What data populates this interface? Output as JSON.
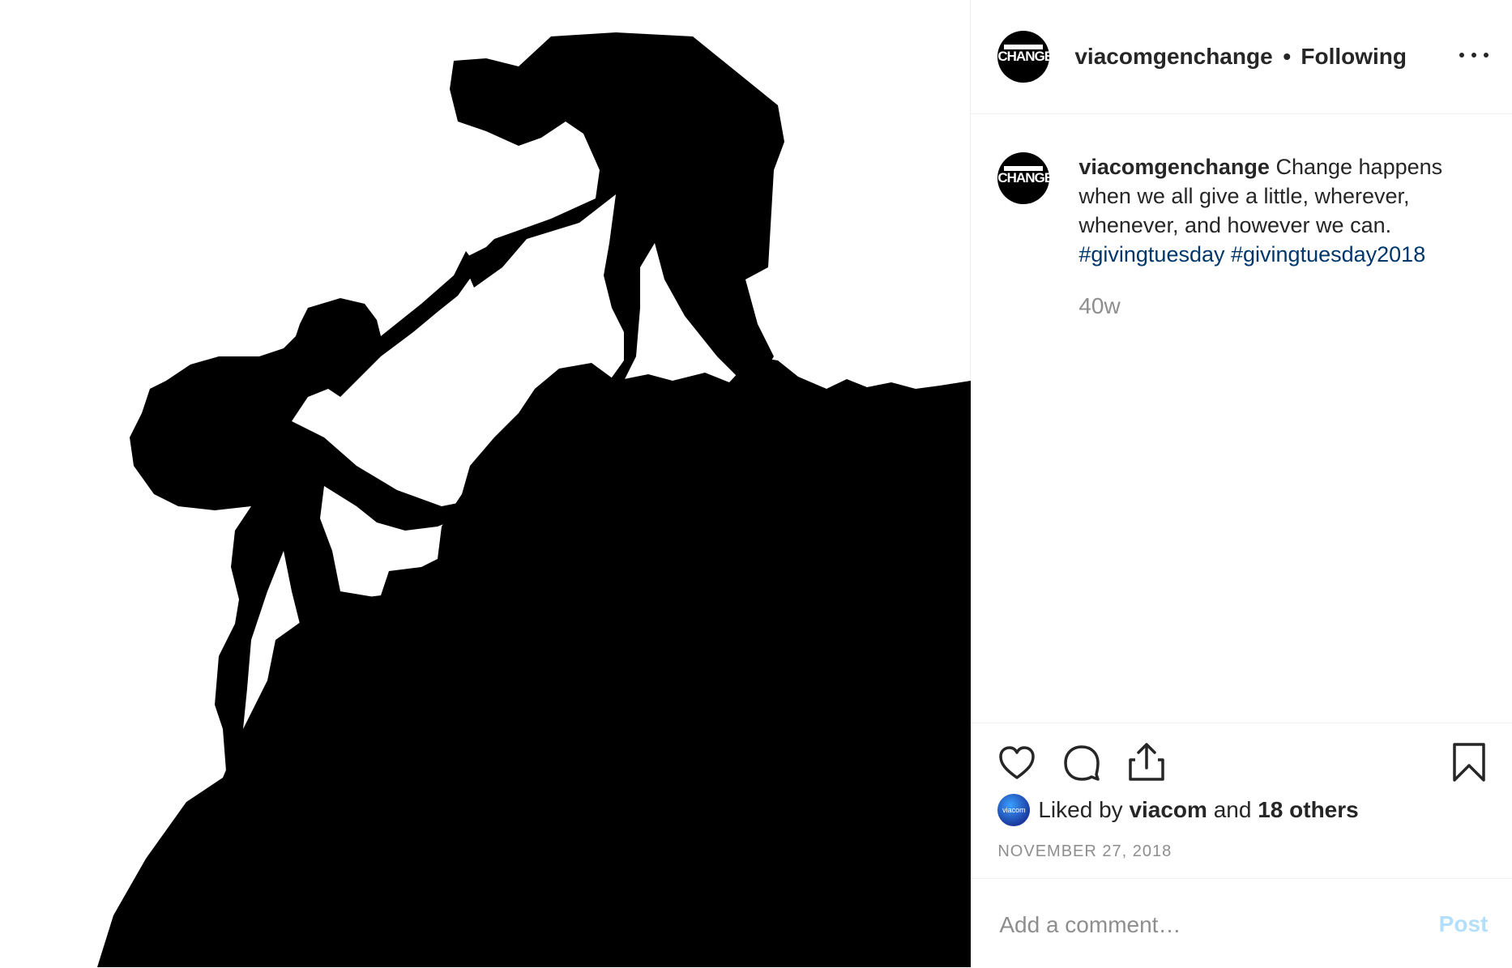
{
  "account": {
    "username": "viacomgenchange",
    "separator": "•",
    "follow_status": "Following",
    "avatar_text": "CHANGE",
    "more_icon": "more-horizontal-icon"
  },
  "caption": {
    "username": "viacomgenchange",
    "text": "Change happens when we all give a little, wherever, whenever, and however we can.",
    "hashtags": [
      "#givingtuesday",
      "#givingtuesday2018"
    ],
    "age": "40w"
  },
  "actions": {
    "like_icon": "heart-icon",
    "comment_icon": "comment-icon",
    "share_icon": "share-icon",
    "save_icon": "bookmark-icon"
  },
  "likes": {
    "avatar_text": "viacom",
    "prefix": "Liked by",
    "user": "viacom",
    "middle": "and",
    "others": "18 others"
  },
  "date": "NOVEMBER 27, 2018",
  "comment": {
    "placeholder": "Add a comment…",
    "post_label": "Post"
  },
  "colors": {
    "hashtag": "#00376b",
    "muted": "#8e8e8e",
    "post_disabled": "#b2dffc",
    "text": "#262626"
  }
}
